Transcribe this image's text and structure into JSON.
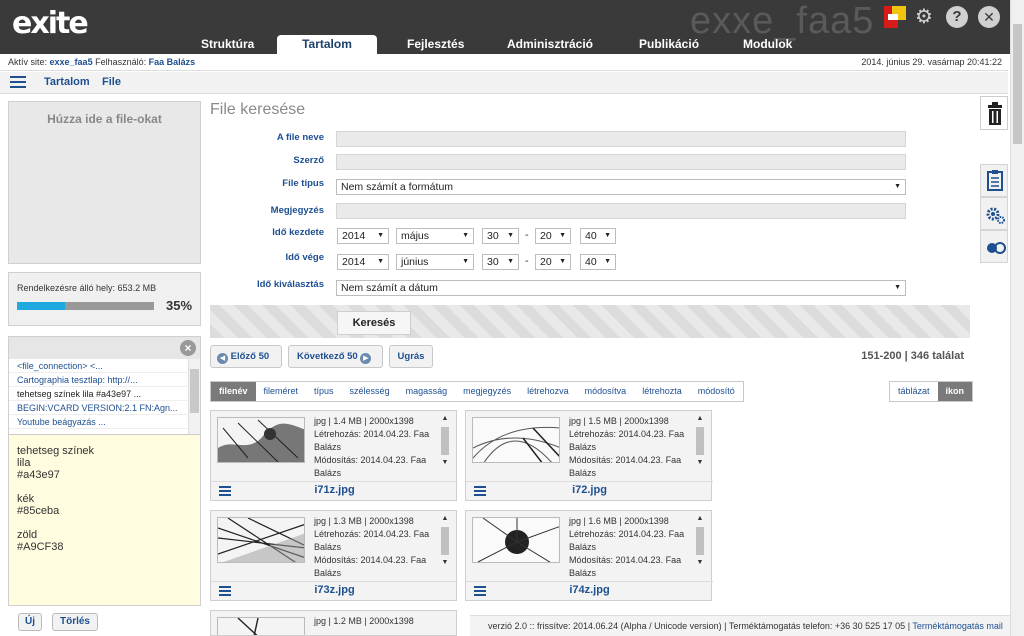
{
  "app": {
    "logo": "exite",
    "site_watermark": "exxe_faa5"
  },
  "nav": {
    "tabs": [
      "Struktúra",
      "Tartalom",
      "Fejlesztés",
      "Adminisztráció",
      "Publikáció",
      "Modulok"
    ],
    "active": "Tartalom"
  },
  "status": {
    "active_site_label": "Aktív site:",
    "active_site": "exxe_faa5",
    "user_label": "Felhasználó:",
    "user": "Faa Balázs",
    "datetime": "2014. június 29. vasárnap 20:41:22"
  },
  "subnav": {
    "items": [
      "Tartalom",
      "File"
    ]
  },
  "sidebar": {
    "dropzone": "Húzza ide a file-okat",
    "storage_label": "Rendelkezésre álló hely: 653.2 MB",
    "storage_percent": "35%",
    "storage_fraction": 0.35,
    "clipboard_items": [
      "<file_connection> <...",
      "Cartographia tesztlap: http://...",
      "tehetseg színek lila #a43e97 ...",
      "BEGIN:VCARD VERSION:2.1 FN:Agn...",
      "Youtube beágyazás ..."
    ],
    "clipboard_text": [
      "tehetseg színek",
      "lila",
      "#a43e97",
      "",
      "kék",
      "#85ceba",
      "",
      "zöld",
      "#A9CF38"
    ],
    "new_button": "Új",
    "delete_button": "Törlés"
  },
  "search": {
    "title": "File keresése",
    "labels": {
      "name": "A file neve",
      "author": "Szerző",
      "filetype": "File típus",
      "comment": "Megjegyzés",
      "start": "Idő kezdete",
      "end": "Idő vége",
      "time_select": "Idő kiválasztás"
    },
    "filetype_value": "Nem számít a formátum",
    "start": {
      "year": "2014",
      "month": "május",
      "day": "30",
      "hour": "20",
      "minute": "40"
    },
    "end": {
      "year": "2014",
      "month": "június",
      "day": "30",
      "hour": "20",
      "minute": "40"
    },
    "time_select_value": "Nem számít a dátum",
    "search_button": "Keresés"
  },
  "results": {
    "prev_button": "Előző 50",
    "next_button": "Következő 50",
    "group_button": "Ugrás",
    "range": "151-200 | 346 találat",
    "sort_options": [
      "filenév",
      "fileméret",
      "típus",
      "szélesség",
      "magasság",
      "megjegyzés",
      "létrehozva",
      "módosítva",
      "létrehozta",
      "módosító"
    ],
    "sort_active": "filenév",
    "view_options": [
      "táblázat",
      "ikon"
    ],
    "view_active": "ikon",
    "files": [
      {
        "name": "i71z.jpg",
        "meta": "jpg | 1.4 MB | 2000x1398",
        "created": "Létrehozás: 2014.04.23. Faa Balázs",
        "modified": "Módosítás: 2014.04.23. Faa Balázs"
      },
      {
        "name": "i72.jpg",
        "meta": "jpg | 1.5 MB | 2000x1398",
        "created": "Létrehozás: 2014.04.23. Faa Balázs",
        "modified": "Módosítás: 2014.04.23. Faa Balázs"
      },
      {
        "name": "i73z.jpg",
        "meta": "jpg | 1.3 MB | 2000x1398",
        "created": "Létrehozás: 2014.04.23. Faa Balázs",
        "modified": "Módosítás: 2014.04.23. Faa Balázs"
      },
      {
        "name": "i74z.jpg",
        "meta": "jpg | 1.6 MB | 2000x1398",
        "created": "Létrehozás: 2014.04.23. Faa Balázs",
        "modified": "Módosítás: 2014.04.23. Faa Balázs"
      },
      {
        "name": "",
        "meta": "jpg | 1.2 MB | 2000x1398",
        "created": "",
        "modified": ""
      }
    ]
  },
  "footer": {
    "version": "verzió 2.0 :: frissítve: 2014.06.24 (Alpha / Unicode version)",
    "support_phone": "Terméktámogatás telefon: +36 30 525 17 05",
    "support_mail": "Terméktámogatás mail"
  },
  "icons": {
    "trash": "trash-icon",
    "clipboard": "clipboard-icon",
    "settings": "gears-icon",
    "toggle": "toggle-icon"
  },
  "colors": {
    "accent": "#1d4f91",
    "topbar": "#3a3a3a",
    "progress": "#1fa9e1",
    "clipboard_bg": "#fffce0"
  }
}
